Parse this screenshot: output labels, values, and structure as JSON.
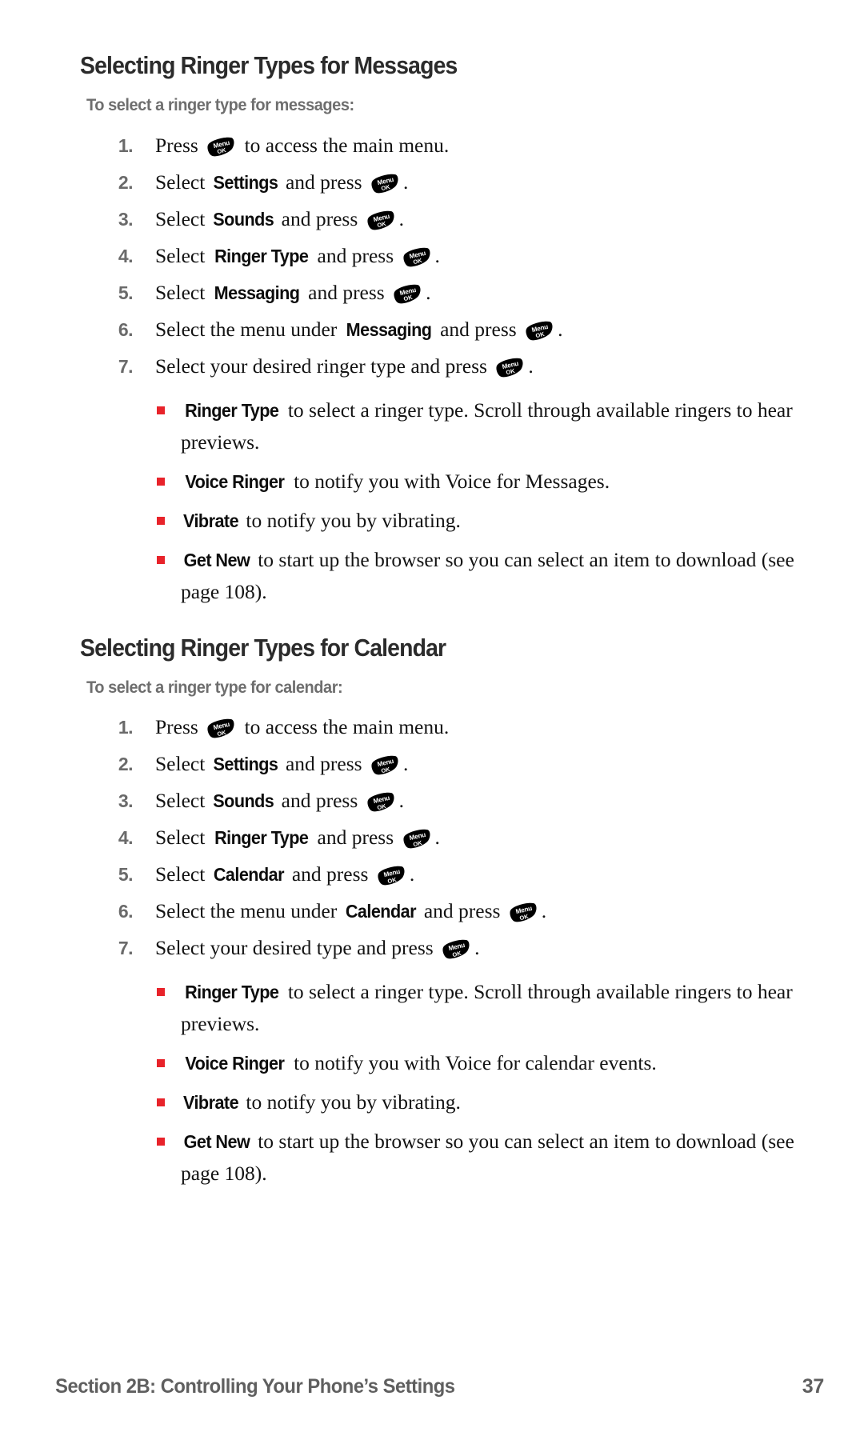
{
  "page": {
    "number": "37",
    "footer_title": "Section 2B: Controlling Your Phone’s Settings",
    "bullet_color": "#e8232a",
    "heading_color": "#2b2b2b",
    "subheading_color": "#6e6e6e"
  },
  "key_icon": {
    "name": "menu-ok-key-icon",
    "line1": "Menu",
    "line2": "OK"
  },
  "sections": [
    {
      "heading": "Selecting Ringer Types for Messages",
      "subheading": "To select a ringer type for messages:",
      "steps": [
        {
          "num": "1.",
          "parts": [
            {
              "t": "Press "
            },
            {
              "key": true
            },
            {
              "t": " to access the main menu."
            }
          ]
        },
        {
          "num": "2.",
          "parts": [
            {
              "t": "Select "
            },
            {
              "b": "Settings"
            },
            {
              "t": " and press "
            },
            {
              "key": true
            },
            {
              "t": "."
            }
          ]
        },
        {
          "num": "3.",
          "parts": [
            {
              "t": "Select "
            },
            {
              "b": "Sounds"
            },
            {
              "t": " and press "
            },
            {
              "key": true
            },
            {
              "t": "."
            }
          ]
        },
        {
          "num": "4.",
          "parts": [
            {
              "t": "Select "
            },
            {
              "b": "Ringer Type"
            },
            {
              "t": " and press "
            },
            {
              "key": true
            },
            {
              "t": "."
            }
          ]
        },
        {
          "num": "5.",
          "parts": [
            {
              "t": "Select "
            },
            {
              "b": "Messaging"
            },
            {
              "t": " and press "
            },
            {
              "key": true
            },
            {
              "t": "."
            }
          ]
        },
        {
          "num": "6.",
          "parts": [
            {
              "t": "Select the menu under "
            },
            {
              "b": "Messaging"
            },
            {
              "t": " and press "
            },
            {
              "key": true
            },
            {
              "t": "."
            }
          ]
        },
        {
          "num": "7.",
          "parts": [
            {
              "t": "Select your desired ringer type and press "
            },
            {
              "key": true
            },
            {
              "t": "."
            }
          ]
        }
      ],
      "bullets": [
        {
          "parts": [
            {
              "b": "Ringer Type"
            },
            {
              "t": " to select a ringer type. Scroll through available ringers to hear previews."
            }
          ]
        },
        {
          "parts": [
            {
              "b": "Voice Ringer"
            },
            {
              "t": " to notify you with Voice for Messages."
            }
          ]
        },
        {
          "parts": [
            {
              "b": "Vibrate"
            },
            {
              "t": " to notify you by vibrating."
            }
          ]
        },
        {
          "parts": [
            {
              "b": "Get New"
            },
            {
              "t": " to start up the browser so you can select an item to download (see page 108)."
            }
          ]
        }
      ]
    },
    {
      "heading": "Selecting Ringer Types for Calendar",
      "subheading": "To select a ringer type for calendar:",
      "steps": [
        {
          "num": "1.",
          "parts": [
            {
              "t": "Press "
            },
            {
              "key": true
            },
            {
              "t": " to access the main menu."
            }
          ]
        },
        {
          "num": "2.",
          "parts": [
            {
              "t": "Select "
            },
            {
              "b": "Settings"
            },
            {
              "t": " and press "
            },
            {
              "key": true
            },
            {
              "t": "."
            }
          ]
        },
        {
          "num": "3.",
          "parts": [
            {
              "t": "Select "
            },
            {
              "b": "Sounds"
            },
            {
              "t": " and press "
            },
            {
              "key": true
            },
            {
              "t": "."
            }
          ]
        },
        {
          "num": "4.",
          "parts": [
            {
              "t": "Select "
            },
            {
              "b": "Ringer Type"
            },
            {
              "t": " and press "
            },
            {
              "key": true
            },
            {
              "t": "."
            }
          ]
        },
        {
          "num": "5.",
          "parts": [
            {
              "t": "Select "
            },
            {
              "b": "Calendar"
            },
            {
              "t": " and press "
            },
            {
              "key": true
            },
            {
              "t": "."
            }
          ]
        },
        {
          "num": "6.",
          "parts": [
            {
              "t": "Select the menu under "
            },
            {
              "b": "Calendar"
            },
            {
              "t": " and press "
            },
            {
              "key": true
            },
            {
              "t": "."
            }
          ]
        },
        {
          "num": "7.",
          "parts": [
            {
              "t": "Select your desired type and press "
            },
            {
              "key": true
            },
            {
              "t": "."
            }
          ]
        }
      ],
      "bullets": [
        {
          "parts": [
            {
              "b": "Ringer Type"
            },
            {
              "t": " to select a ringer type. Scroll through available ringers to hear previews."
            }
          ]
        },
        {
          "parts": [
            {
              "b": "Voice Ringer"
            },
            {
              "t": " to notify you with Voice for calendar events."
            }
          ]
        },
        {
          "parts": [
            {
              "b": "Vibrate"
            },
            {
              "t": " to notify you by vibrating."
            }
          ]
        },
        {
          "parts": [
            {
              "b": "Get New"
            },
            {
              "t": " to start up the browser so you can select an item to download (see page 108)."
            }
          ]
        }
      ]
    }
  ]
}
